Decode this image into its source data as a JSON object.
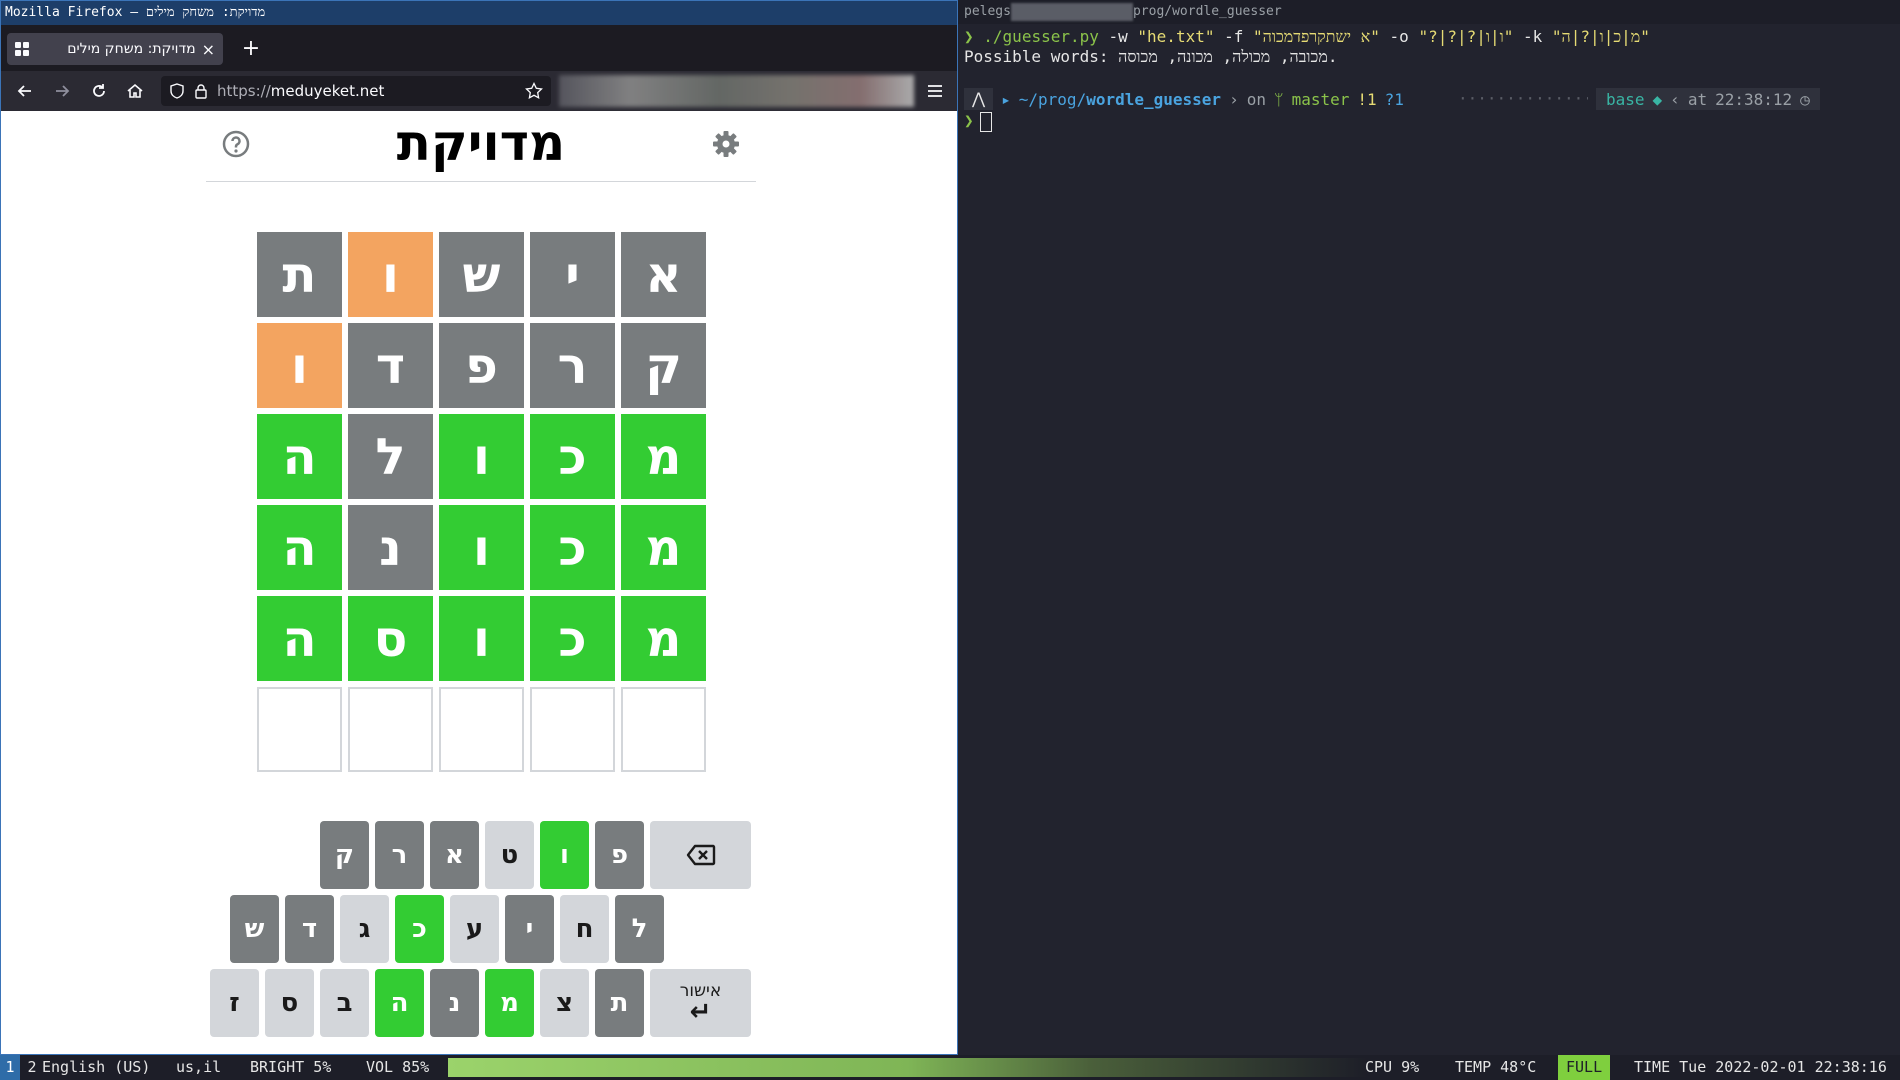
{
  "firefox": {
    "window_title": "Mozilla Firefox — מדויקת: משחק מילים",
    "tab_title": "מדויקת: משחק מילים",
    "tab_close": "×",
    "new_tab": "+",
    "url_scheme": "https://",
    "url_host": "meduyeket.net"
  },
  "game": {
    "title": "מדויקת",
    "board": [
      [
        {
          "l": "א",
          "s": "absent"
        },
        {
          "l": "י",
          "s": "absent"
        },
        {
          "l": "ש",
          "s": "absent"
        },
        {
          "l": "ו",
          "s": "present"
        },
        {
          "l": "ת",
          "s": "absent"
        }
      ],
      [
        {
          "l": "ק",
          "s": "absent"
        },
        {
          "l": "ר",
          "s": "absent"
        },
        {
          "l": "פ",
          "s": "absent"
        },
        {
          "l": "ד",
          "s": "absent"
        },
        {
          "l": "ו",
          "s": "present"
        }
      ],
      [
        {
          "l": "מ",
          "s": "correct"
        },
        {
          "l": "כ",
          "s": "correct"
        },
        {
          "l": "ו",
          "s": "correct"
        },
        {
          "l": "ל",
          "s": "absent"
        },
        {
          "l": "ה",
          "s": "correct"
        }
      ],
      [
        {
          "l": "מ",
          "s": "correct"
        },
        {
          "l": "כ",
          "s": "correct"
        },
        {
          "l": "ו",
          "s": "correct"
        },
        {
          "l": "נ",
          "s": "absent"
        },
        {
          "l": "ה",
          "s": "correct"
        }
      ],
      [
        {
          "l": "מ",
          "s": "correct"
        },
        {
          "l": "כ",
          "s": "correct"
        },
        {
          "l": "ו",
          "s": "correct"
        },
        {
          "l": "ס",
          "s": "correct"
        },
        {
          "l": "ה",
          "s": "correct"
        }
      ],
      [
        {
          "l": "",
          "s": "empty"
        },
        {
          "l": "",
          "s": "empty"
        },
        {
          "l": "",
          "s": "empty"
        },
        {
          "l": "",
          "s": "empty"
        },
        {
          "l": "",
          "s": "empty"
        }
      ]
    ],
    "keyboard": [
      [
        {
          "k": "backspace",
          "s": "unused"
        },
        {
          "k": "פ",
          "s": "absent"
        },
        {
          "k": "ו",
          "s": "correct"
        },
        {
          "k": "ט",
          "s": "unused"
        },
        {
          "k": "א",
          "s": "absent"
        },
        {
          "k": "ר",
          "s": "absent"
        },
        {
          "k": "ק",
          "s": "absent"
        }
      ],
      [
        {
          "k": "ל",
          "s": "absent"
        },
        {
          "k": "ח",
          "s": "unused"
        },
        {
          "k": "י",
          "s": "absent"
        },
        {
          "k": "ע",
          "s": "unused"
        },
        {
          "k": "כ",
          "s": "correct"
        },
        {
          "k": "ג",
          "s": "unused"
        },
        {
          "k": "ד",
          "s": "absent"
        },
        {
          "k": "ש",
          "s": "absent"
        }
      ],
      [
        {
          "k": "enter",
          "s": "unused"
        },
        {
          "k": "ת",
          "s": "absent"
        },
        {
          "k": "צ",
          "s": "unused"
        },
        {
          "k": "מ",
          "s": "correct"
        },
        {
          "k": "נ",
          "s": "absent"
        },
        {
          "k": "ה",
          "s": "correct"
        },
        {
          "k": "ב",
          "s": "unused"
        },
        {
          "k": "ס",
          "s": "unused"
        },
        {
          "k": "ז",
          "s": "unused"
        }
      ]
    ],
    "enter_label": "אישור",
    "enter_arrow": "↵"
  },
  "terminal": {
    "title_prefix": "pelegs",
    "title_suffix": "prog/wordle_guesser",
    "prompt_symbol": "❯",
    "command": "./guesser.py",
    "args_1": " -w ",
    "arg_w": "\"he.txt\"",
    "args_2": " -f ",
    "arg_f": "\"א ישתקרפדמכוה\"",
    "args_3": " -o ",
    "arg_o": "\"?|?|?|ו|ו\"",
    "args_4": " -k ",
    "arg_k": "\"מ|כ|ו|?|ה\"",
    "output": "Possible words: מכובה, מכולה, מכונה, מכוסה.",
    "path_home": "~/prog/",
    "path_dir": "wordle_guesser",
    "on": "on",
    "branch": "master",
    "git_status_modified": "!1",
    "git_status_untracked": "?1",
    "dots": "··················",
    "env": "base",
    "at": "at",
    "time": "22:38:12"
  },
  "statusbar": {
    "ws1": "1",
    "ws2": "2",
    "lang": "English (US)",
    "layout": "us,il",
    "bright": "BRIGHT  5%",
    "vol": "VOL 85%",
    "cpu": "CPU  9%",
    "temp": "TEMP  48°C",
    "battery": "FULL",
    "time": "TIME Tue 2022-02-01 22:38:16"
  }
}
